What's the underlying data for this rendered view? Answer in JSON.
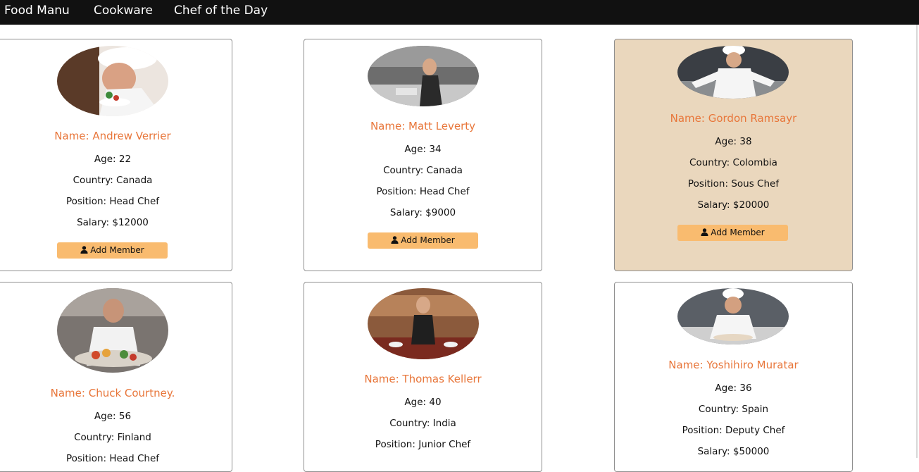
{
  "nav": {
    "items": [
      "Food Manu",
      "Cookware",
      "Chef of the Day"
    ]
  },
  "chefs": [
    {
      "name": "Name: Andrew Verrier",
      "age": "Age: 22",
      "country": "Country: Canada",
      "position": "Position: Head Chef",
      "salary": "Salary: $12000",
      "button": "Add Member",
      "highlighted": false
    },
    {
      "name": "Name: Matt Leverty",
      "age": "Age: 34",
      "country": "Country: Canada",
      "position": "Position: Head Chef",
      "salary": "Salary: $9000",
      "button": "Add Member",
      "highlighted": false
    },
    {
      "name": "Name: Gordon Ramsayr",
      "age": "Age: 38",
      "country": "Country: Colombia",
      "position": "Position: Sous Chef",
      "salary": "Salary: $20000",
      "button": "Add Member",
      "highlighted": true
    },
    {
      "name": "Name: Chuck Courtney.",
      "age": "Age: 56",
      "country": "Country: Finland",
      "position": "Position: Head Chef"
    },
    {
      "name": "Name: Thomas Kellerr",
      "age": "Age: 40",
      "country": "Country: India",
      "position": "Position: Junior Chef"
    },
    {
      "name": "Name: Yoshihiro Muratar",
      "age": "Age: 36",
      "country": "Country: Spain",
      "position": "Position: Deputy Chef",
      "salary": "Salary: $50000"
    }
  ],
  "colors": {
    "accent_name": "#e8763a",
    "button_bg": "#f9bb6f",
    "highlight_bg": "#ead7bd",
    "navbar_bg": "#111111"
  },
  "icons": {
    "button_icon": "user-icon",
    "photo": "chef-photo"
  }
}
